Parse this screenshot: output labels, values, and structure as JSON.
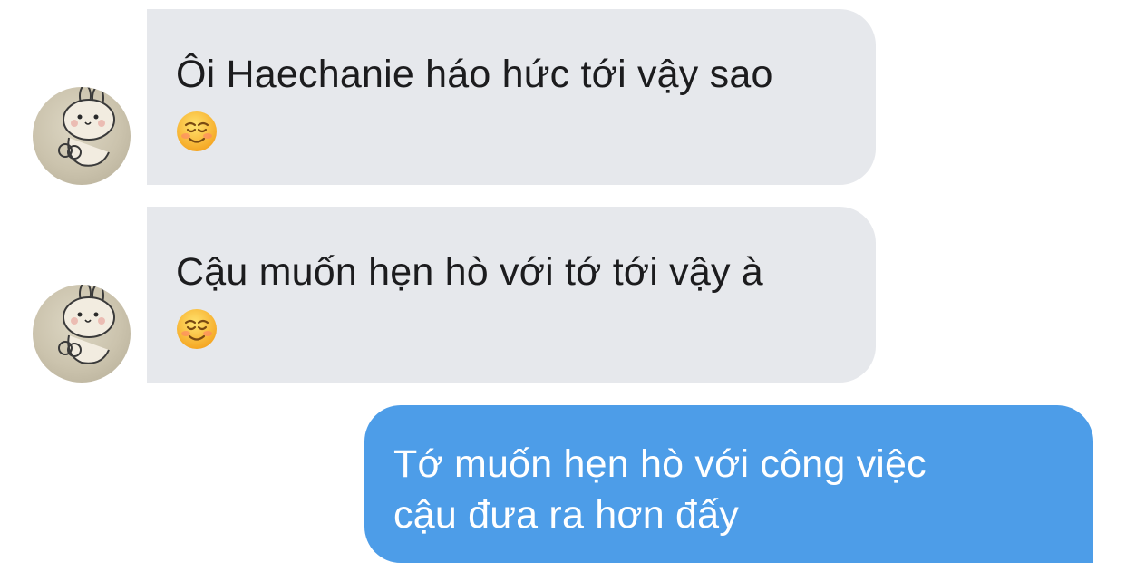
{
  "messages": [
    {
      "direction": "incoming",
      "lines": [
        "Ôi Haechanie háo hức tới vậy sao"
      ],
      "emoji": "smiling-face-with-smiling-eyes"
    },
    {
      "direction": "incoming",
      "lines": [
        "Cậu muốn hẹn hò với tớ tới vậy à"
      ],
      "emoji": "smiling-face-with-smiling-eyes"
    },
    {
      "direction": "outgoing",
      "lines": [
        "Tớ muốn hẹn hò với công việc",
        "cậu đưa ra hơn đấy"
      ]
    }
  ],
  "colors": {
    "incoming_bubble": "#e6e8ec",
    "outgoing_bubble": "#4d9de8",
    "incoming_text": "#1c1c1e",
    "outgoing_text": "#ffffff"
  }
}
